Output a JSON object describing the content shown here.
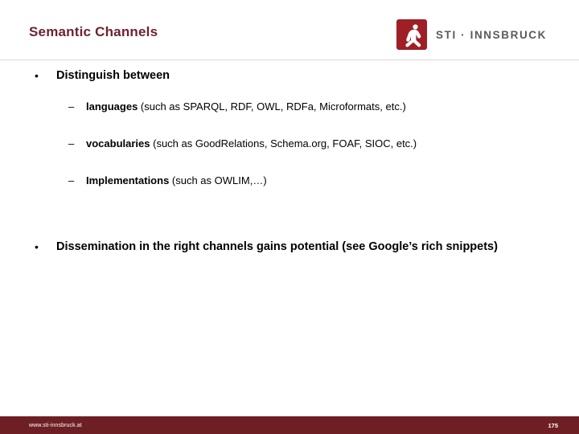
{
  "slide": {
    "title": "Semantic Channels",
    "title_color": "#6e2230",
    "accent_color": "#9e1f26",
    "footer_bar_color": "#6e1f24"
  },
  "logo": {
    "mark_name": "sti-innsbruck-figure-icon",
    "text": "STI · INNSBRUCK"
  },
  "bullets": {
    "first": {
      "marker": "•",
      "text": "Distinguish between"
    },
    "sub": [
      {
        "marker": "–",
        "bold": "languages",
        "rest": " (such as SPARQL, RDF, OWL, RDFa, Microformats, etc.)"
      },
      {
        "marker": "–",
        "bold": "vocabularies",
        "rest": " (such as GoodRelations, Schema.org, FOAF, SIOC, etc.)"
      },
      {
        "marker": "–",
        "bold": "Implementations",
        "rest": " (such as OWLIM,…)"
      }
    ],
    "second": {
      "marker": "•",
      "text": "Dissemination in the right channels gains potential (see Google’s rich snippets)"
    }
  },
  "footer": {
    "url": "www.sti-innsbruck.at",
    "page_number": "175"
  }
}
